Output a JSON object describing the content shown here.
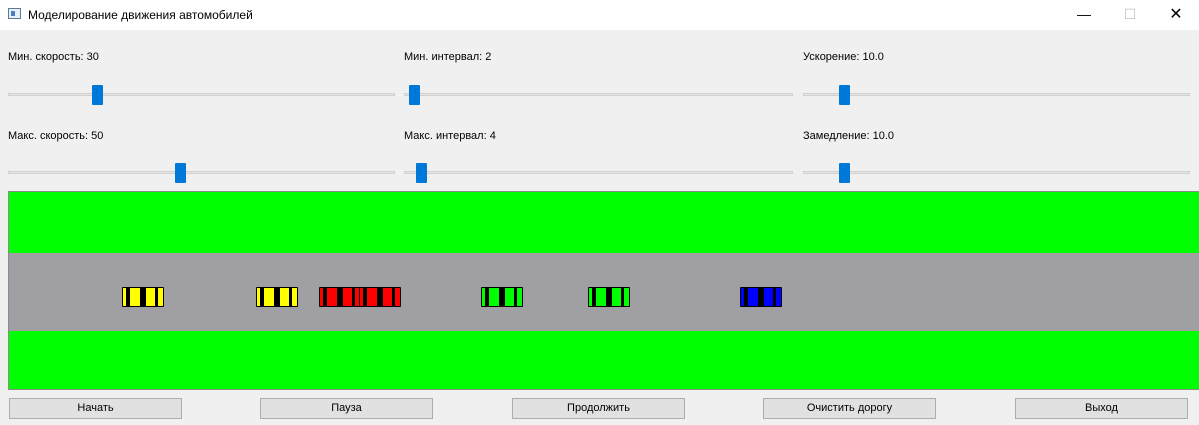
{
  "window": {
    "title": "Моделирование движения автомобилей",
    "icon": "app-window-icon",
    "minimize_glyph": "—",
    "maximize_glyph": "☐",
    "close_glyph": "✕"
  },
  "controls": {
    "min_speed": {
      "label": "Мин. скорость: 30",
      "value": 30
    },
    "max_speed": {
      "label": "Макс. скорость: 50",
      "value": 50
    },
    "min_interval": {
      "label": "Мин. интервал: 2",
      "value": 2
    },
    "max_interval": {
      "label": "Макс. интервал: 4",
      "value": 4
    },
    "acceleration": {
      "label": "Ускорение: 10.0",
      "value": 10.0
    },
    "deceleration": {
      "label": "Замедление: 10.0",
      "value": 10.0
    }
  },
  "colors": {
    "grass": "#00ff00",
    "road": "#a0a0a4",
    "slider_handle": "#0078d7",
    "car_yellow": "#ffff00",
    "car_red": "#ff0000",
    "car_green": "#00ff00",
    "car_blue": "#0000ff"
  },
  "cars": [
    {
      "color": "yellow"
    },
    {
      "color": "yellow"
    },
    {
      "color": "red"
    },
    {
      "color": "red"
    },
    {
      "color": "green"
    },
    {
      "color": "green"
    },
    {
      "color": "blue"
    }
  ],
  "buttons": {
    "start": "Начать",
    "pause": "Пауза",
    "resume": "Продолжить",
    "clear": "Очистить дорогу",
    "exit": "Выход"
  }
}
